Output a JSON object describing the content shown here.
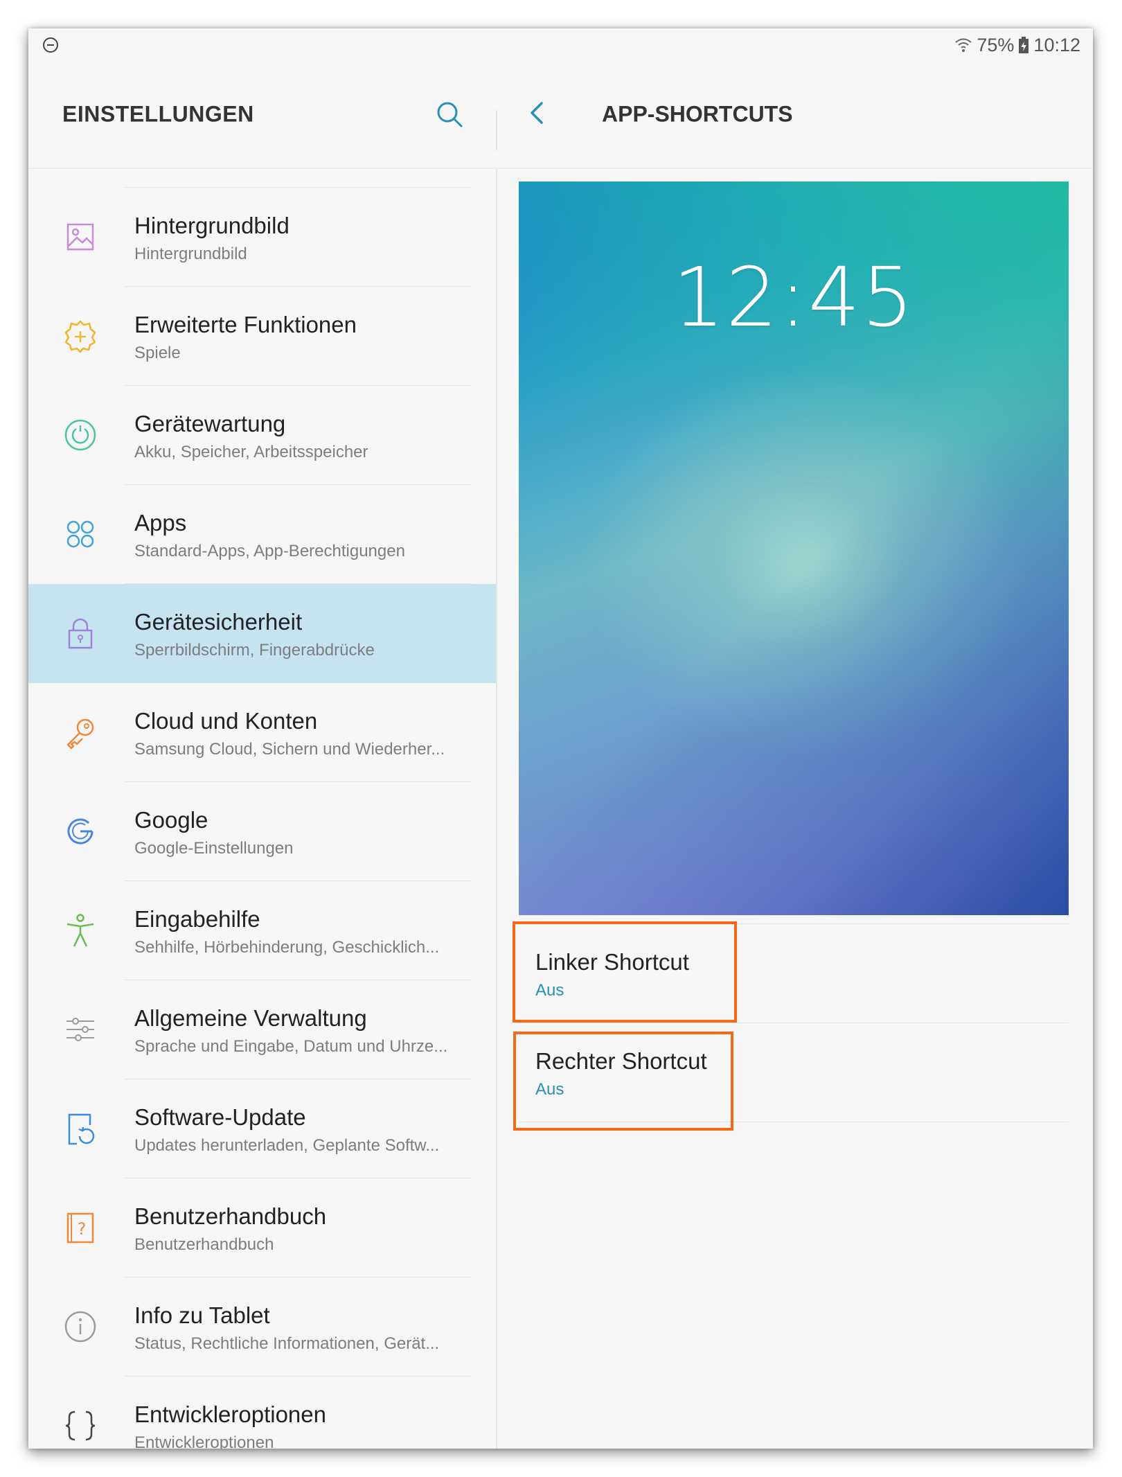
{
  "status_bar": {
    "left_icon": "do-not-disturb-icon",
    "battery_percent": "75%",
    "time": "10:12"
  },
  "left_header": {
    "title": "EINSTELLUNGEN",
    "search_icon": "search-icon"
  },
  "right_header": {
    "back_icon": "chevron-left-icon",
    "title": "APP-SHORTCUTS"
  },
  "menu": [
    {
      "title": "Hintergrundbild",
      "subtitle": "Hintergrundbild",
      "icon": "wallpaper-icon",
      "selected": false
    },
    {
      "title": "Erweiterte Funktionen",
      "subtitle": "Spiele",
      "icon": "gear-plus-icon",
      "selected": false
    },
    {
      "title": "Gerätewartung",
      "subtitle": "Akku, Speicher, Arbeitsspeicher",
      "icon": "refresh-circle-icon",
      "selected": false
    },
    {
      "title": "Apps",
      "subtitle": "Standard-Apps, App-Berechtigungen",
      "icon": "apps-grid-icon",
      "selected": false
    },
    {
      "title": "Gerätesicherheit",
      "subtitle": "Sperrbildschirm, Fingerabdrücke",
      "icon": "lock-icon",
      "selected": true
    },
    {
      "title": "Cloud und Konten",
      "subtitle": "Samsung Cloud, Sichern und Wiederher...",
      "icon": "key-icon",
      "selected": false
    },
    {
      "title": "Google",
      "subtitle": "Google-Einstellungen",
      "icon": "google-icon",
      "selected": false
    },
    {
      "title": "Eingabehilfe",
      "subtitle": "Sehhilfe, Hörbehinderung, Geschicklich...",
      "icon": "accessibility-icon",
      "selected": false
    },
    {
      "title": "Allgemeine Verwaltung",
      "subtitle": "Sprache und Eingabe, Datum und Uhrze...",
      "icon": "sliders-icon",
      "selected": false
    },
    {
      "title": "Software-Update",
      "subtitle": "Updates herunterladen, Geplante Softw...",
      "icon": "software-update-icon",
      "selected": false
    },
    {
      "title": "Benutzerhandbuch",
      "subtitle": "Benutzerhandbuch",
      "icon": "help-book-icon",
      "selected": false
    },
    {
      "title": "Info zu Tablet",
      "subtitle": "Status, Rechtliche Informationen, Gerät...",
      "icon": "info-icon",
      "selected": false
    },
    {
      "title": "Entwickleroptionen",
      "subtitle": "Entwickleroptionen",
      "icon": "braces-icon",
      "selected": false
    }
  ],
  "preview": {
    "clock": "12:45"
  },
  "shortcuts": [
    {
      "title": "Linker Shortcut",
      "value": "Aus"
    },
    {
      "title": "Rechter Shortcut",
      "value": "Aus"
    }
  ],
  "colors": {
    "accent": "#2a8fb8",
    "selected_bg": "#c6e4f0",
    "highlight_border": "#f26a17"
  }
}
